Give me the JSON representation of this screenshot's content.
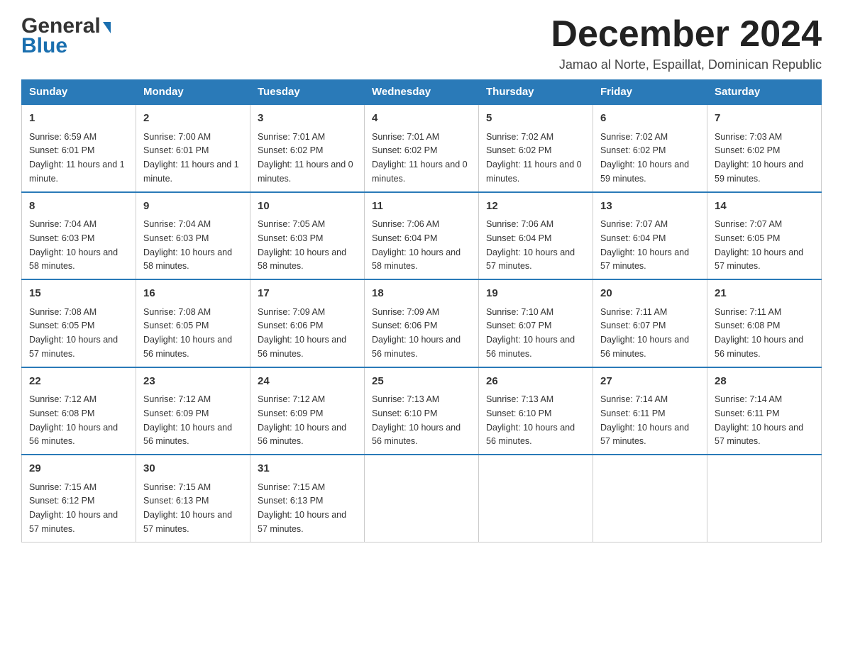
{
  "logo": {
    "brand": "General",
    "brand2": "Blue"
  },
  "header": {
    "month_title": "December 2024",
    "subtitle": "Jamao al Norte, Espaillat, Dominican Republic"
  },
  "days_of_week": [
    "Sunday",
    "Monday",
    "Tuesday",
    "Wednesday",
    "Thursday",
    "Friday",
    "Saturday"
  ],
  "weeks": [
    [
      {
        "day": "1",
        "sunrise": "6:59 AM",
        "sunset": "6:01 PM",
        "daylight": "11 hours and 1 minute."
      },
      {
        "day": "2",
        "sunrise": "7:00 AM",
        "sunset": "6:01 PM",
        "daylight": "11 hours and 1 minute."
      },
      {
        "day": "3",
        "sunrise": "7:01 AM",
        "sunset": "6:02 PM",
        "daylight": "11 hours and 0 minutes."
      },
      {
        "day": "4",
        "sunrise": "7:01 AM",
        "sunset": "6:02 PM",
        "daylight": "11 hours and 0 minutes."
      },
      {
        "day": "5",
        "sunrise": "7:02 AM",
        "sunset": "6:02 PM",
        "daylight": "11 hours and 0 minutes."
      },
      {
        "day": "6",
        "sunrise": "7:02 AM",
        "sunset": "6:02 PM",
        "daylight": "10 hours and 59 minutes."
      },
      {
        "day": "7",
        "sunrise": "7:03 AM",
        "sunset": "6:02 PM",
        "daylight": "10 hours and 59 minutes."
      }
    ],
    [
      {
        "day": "8",
        "sunrise": "7:04 AM",
        "sunset": "6:03 PM",
        "daylight": "10 hours and 58 minutes."
      },
      {
        "day": "9",
        "sunrise": "7:04 AM",
        "sunset": "6:03 PM",
        "daylight": "10 hours and 58 minutes."
      },
      {
        "day": "10",
        "sunrise": "7:05 AM",
        "sunset": "6:03 PM",
        "daylight": "10 hours and 58 minutes."
      },
      {
        "day": "11",
        "sunrise": "7:06 AM",
        "sunset": "6:04 PM",
        "daylight": "10 hours and 58 minutes."
      },
      {
        "day": "12",
        "sunrise": "7:06 AM",
        "sunset": "6:04 PM",
        "daylight": "10 hours and 57 minutes."
      },
      {
        "day": "13",
        "sunrise": "7:07 AM",
        "sunset": "6:04 PM",
        "daylight": "10 hours and 57 minutes."
      },
      {
        "day": "14",
        "sunrise": "7:07 AM",
        "sunset": "6:05 PM",
        "daylight": "10 hours and 57 minutes."
      }
    ],
    [
      {
        "day": "15",
        "sunrise": "7:08 AM",
        "sunset": "6:05 PM",
        "daylight": "10 hours and 57 minutes."
      },
      {
        "day": "16",
        "sunrise": "7:08 AM",
        "sunset": "6:05 PM",
        "daylight": "10 hours and 56 minutes."
      },
      {
        "day": "17",
        "sunrise": "7:09 AM",
        "sunset": "6:06 PM",
        "daylight": "10 hours and 56 minutes."
      },
      {
        "day": "18",
        "sunrise": "7:09 AM",
        "sunset": "6:06 PM",
        "daylight": "10 hours and 56 minutes."
      },
      {
        "day": "19",
        "sunrise": "7:10 AM",
        "sunset": "6:07 PM",
        "daylight": "10 hours and 56 minutes."
      },
      {
        "day": "20",
        "sunrise": "7:11 AM",
        "sunset": "6:07 PM",
        "daylight": "10 hours and 56 minutes."
      },
      {
        "day": "21",
        "sunrise": "7:11 AM",
        "sunset": "6:08 PM",
        "daylight": "10 hours and 56 minutes."
      }
    ],
    [
      {
        "day": "22",
        "sunrise": "7:12 AM",
        "sunset": "6:08 PM",
        "daylight": "10 hours and 56 minutes."
      },
      {
        "day": "23",
        "sunrise": "7:12 AM",
        "sunset": "6:09 PM",
        "daylight": "10 hours and 56 minutes."
      },
      {
        "day": "24",
        "sunrise": "7:12 AM",
        "sunset": "6:09 PM",
        "daylight": "10 hours and 56 minutes."
      },
      {
        "day": "25",
        "sunrise": "7:13 AM",
        "sunset": "6:10 PM",
        "daylight": "10 hours and 56 minutes."
      },
      {
        "day": "26",
        "sunrise": "7:13 AM",
        "sunset": "6:10 PM",
        "daylight": "10 hours and 56 minutes."
      },
      {
        "day": "27",
        "sunrise": "7:14 AM",
        "sunset": "6:11 PM",
        "daylight": "10 hours and 57 minutes."
      },
      {
        "day": "28",
        "sunrise": "7:14 AM",
        "sunset": "6:11 PM",
        "daylight": "10 hours and 57 minutes."
      }
    ],
    [
      {
        "day": "29",
        "sunrise": "7:15 AM",
        "sunset": "6:12 PM",
        "daylight": "10 hours and 57 minutes."
      },
      {
        "day": "30",
        "sunrise": "7:15 AM",
        "sunset": "6:13 PM",
        "daylight": "10 hours and 57 minutes."
      },
      {
        "day": "31",
        "sunrise": "7:15 AM",
        "sunset": "6:13 PM",
        "daylight": "10 hours and 57 minutes."
      },
      null,
      null,
      null,
      null
    ]
  ]
}
